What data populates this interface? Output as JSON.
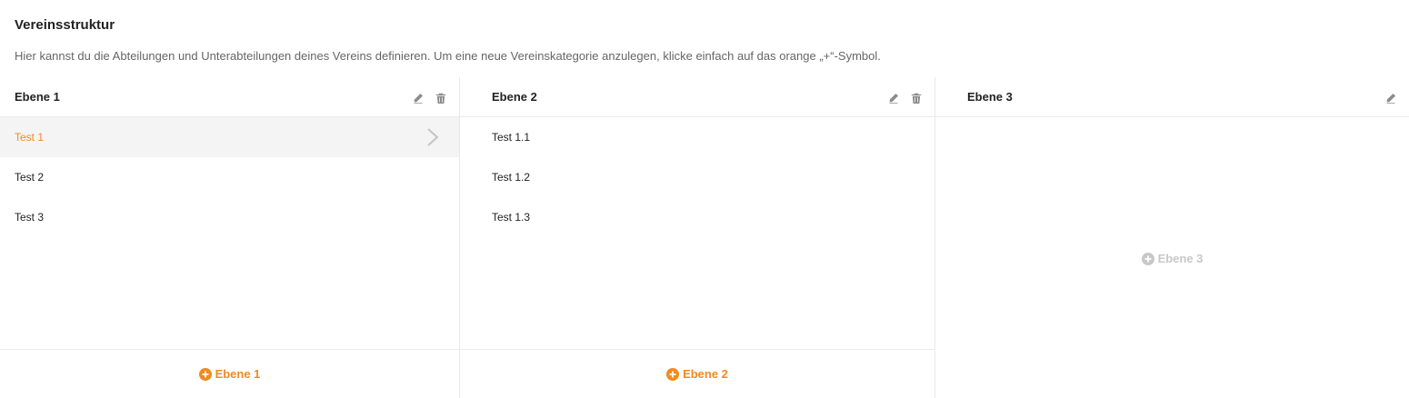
{
  "page": {
    "title": "Vereinsstruktur",
    "description": "Hier kannst du die Abteilungen und Unterabteilungen deines Vereins definieren. Um eine neue Vereinskategorie anzulegen, klicke einfach auf das orange „+“-Symbol."
  },
  "colors": {
    "accent": "#f28a1e",
    "disabled": "#c8c8c8",
    "active_bg": "#f4f4f4"
  },
  "columns": [
    {
      "title": "Ebene 1",
      "actions": [
        "pencil-icon",
        "trash-icon"
      ],
      "items": [
        {
          "label": "Test 1",
          "active": true
        },
        {
          "label": "Test 2",
          "active": false
        },
        {
          "label": "Test 3",
          "active": false
        }
      ],
      "add_label": "Ebene 1"
    },
    {
      "title": "Ebene 2",
      "actions": [
        "pencil-icon",
        "trash-icon"
      ],
      "items": [
        {
          "label": "Test 1.1",
          "active": false
        },
        {
          "label": "Test 1.2",
          "active": false
        },
        {
          "label": "Test 1.3",
          "active": false
        }
      ],
      "add_label": "Ebene 2"
    },
    {
      "title": "Ebene 3",
      "actions": [
        "pencil-icon"
      ],
      "items": [],
      "add_label": "Ebene 3"
    }
  ]
}
